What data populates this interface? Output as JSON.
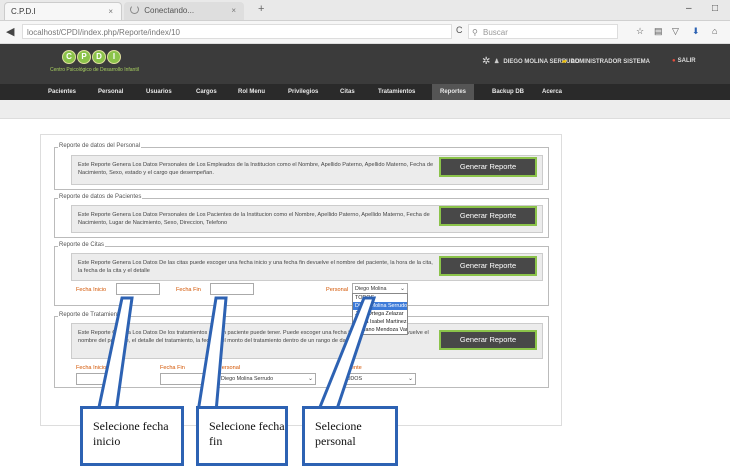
{
  "browser": {
    "tabs": [
      {
        "label": "C.P.D.I",
        "close": "×"
      },
      {
        "label": "Conectando...",
        "close": "×"
      }
    ],
    "new_tab": "+",
    "window_controls": [
      "–",
      "□"
    ],
    "url": "localhost/CPDI/index.php/Reporte/index/10",
    "search_placeholder": "Buscar",
    "reload": "C"
  },
  "header": {
    "logo_letters": [
      "C",
      "P",
      "D",
      "I"
    ],
    "logo_subtitle": "Centro Psicológico de Desarrollo Infantil",
    "user_name": "DIEGO MOLINA SERRUDO",
    "user_role": "ADMINISTRADOR SISTEMA",
    "logout": "SALIR"
  },
  "menu": {
    "items": [
      "Pacientes",
      "Personal",
      "Usuarios",
      "Cargos",
      "Rol Menu",
      "Privilegios",
      "Citas",
      "Tratamientos",
      "Reportes",
      "Backup DB",
      "Acerca"
    ],
    "active": "Reportes"
  },
  "reports": {
    "personal": {
      "legend": "Reporte de datos del Personal",
      "description": "Este Reporte Genera Los Datos Personales de Los Empleados de la Institucion como el Nombre, Apellido Paterno, Apellido Materno, Fecha de Nacimiento, Sexo, estado y el cargo que desempeñan.",
      "button": "Generar Reporte"
    },
    "pacientes": {
      "legend": "Reporte de datos de Pacientes",
      "description": "Este Reporte Genera Los Datos Personales de Los Pacientes de la Institucion como el Nombre, Apellido Paterno, Apellido Materno, Fecha de Nacimiento, Lugar de Nacimiento, Sexo, Direccion, Telefono",
      "button": "Generar Reporte"
    },
    "citas": {
      "legend": "Reporte de Citas",
      "description": "Este Reporte Genera Los Datos De las citas puede escoger una fecha inicio y una fecha fin devuelve el nombre del paciente, la hora de la cita, la fecha de la cita y el detalle",
      "fecha_inicio_label": "Fecha Inicio",
      "fecha_fin_label": "Fecha Fin",
      "personal_label": "Personal",
      "personal_selected": "Diego Molina Serrudo",
      "personal_options": [
        "TODOS",
        "Diego Molina Serrudo",
        "Julio Ortega Zelazar",
        "Maria Isabel Martinez Grandez",
        "Mariano Mendoza Vargas"
      ],
      "button": "Generar Reporte"
    },
    "tratamientos": {
      "legend": "Reporte de Tratamientos",
      "description": "Este Reporte Genera Los Datos De los tratamientos que un paciente puede tener. Puede escoger una fecha inicio y una fecha fin devuelve el nombre del paciente, el detalle del tratamiento, la fecha y el monto del tratamiento dentro de un rango de datos",
      "fecha_inicio_label": "Fecha Inicio",
      "fecha_fin_label": "Fecha Fin",
      "personal_label": "Personal",
      "personal_selected": "Diego Molina Serrudo",
      "paciente_label": "Paciente",
      "paciente_selected": "TODOS",
      "button": "Generar Reporte"
    }
  },
  "callouts": {
    "fecha_inicio": "Selecione fecha inicio",
    "fecha_fin": "Selecione fecha fin",
    "personal": "Selecione personal"
  },
  "colors": {
    "callout_border": "#2d62b3",
    "button_border": "#8bc34a",
    "label": "#d35400",
    "selected_option": "#3d7bd9"
  }
}
